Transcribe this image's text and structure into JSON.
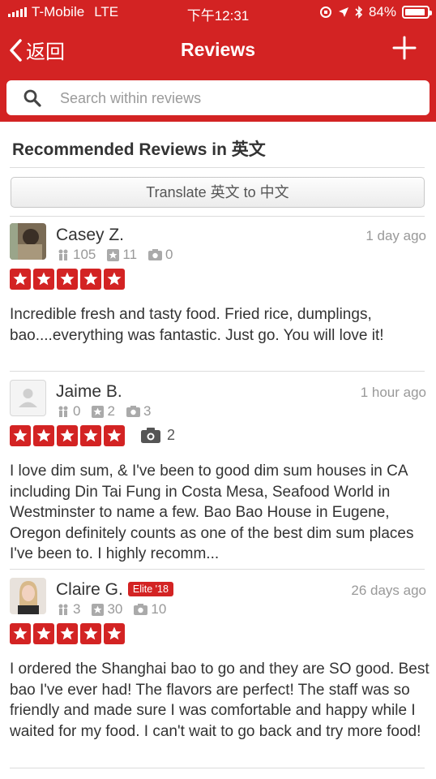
{
  "status_bar": {
    "carrier": "T-Mobile",
    "network": "LTE",
    "time": "下午12:31",
    "battery": "84%"
  },
  "nav": {
    "back_label": "返回",
    "title": "Reviews"
  },
  "search": {
    "placeholder": "Search within reviews"
  },
  "section": {
    "title": "Recommended Reviews in 英文",
    "translate_label": "Translate 英文 to 中文"
  },
  "reviews": [
    {
      "name": "Casey Z.",
      "time": "1 day ago",
      "friends": "105",
      "reviews": "11",
      "photos": "0",
      "rating": 5,
      "text": "Incredible fresh and tasty food. Fried rice, dumplings, bao....everything was fantastic. Just go. You will love it!"
    },
    {
      "name": "Jaime B.",
      "time": "1 hour ago",
      "friends": "0",
      "reviews": "2",
      "photos": "3",
      "rating": 5,
      "review_photos": "2",
      "text": "I love dim sum, & I've been to good dim sum houses in CA including Din Tai Fung in Costa Mesa, Seafood World in Westminster to name a few. Bao Bao House in Eugene, Oregon definitely counts as one of the best dim sum places I've been to. I highly recomm..."
    },
    {
      "name": "Claire G.",
      "elite": "Elite '18",
      "time": "26 days ago",
      "friends": "3",
      "reviews": "30",
      "photos": "10",
      "rating": 5,
      "text": "I ordered the Shanghai bao to go and they are SO good. Best bao I've ever had! The flavors are perfect! The staff was so friendly and made sure I was comfortable and happy while I waited for my food. I can't wait to go back and try more food!"
    }
  ],
  "colors": {
    "brand": "#d32323",
    "muted": "#999999",
    "text": "#333333"
  }
}
